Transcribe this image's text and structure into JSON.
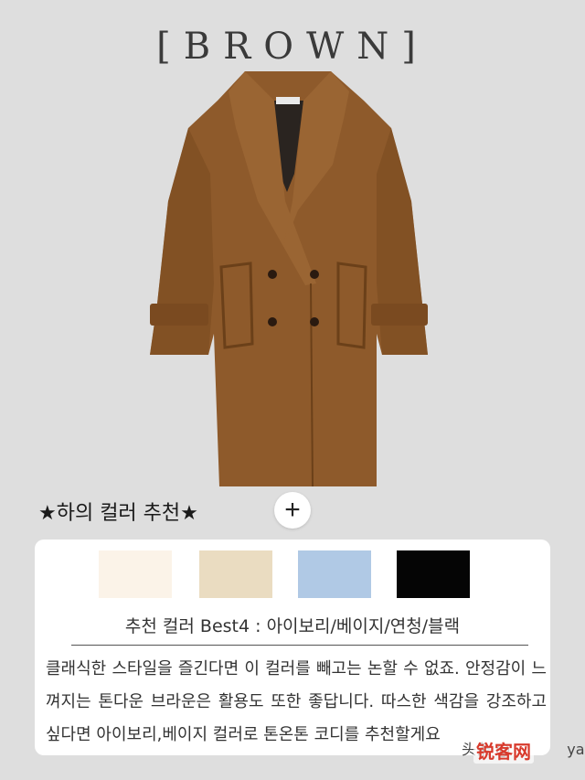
{
  "header": {
    "title": "[BROWN]"
  },
  "product": {
    "image_alt": "brown double-breasted wool coat"
  },
  "section": {
    "heading": "★하의 컬러 추천★",
    "plus_label": "+"
  },
  "swatches": [
    {
      "name": "아이보리",
      "color": "#fbf3e8"
    },
    {
      "name": "베이지",
      "color": "#eadcc1"
    },
    {
      "name": "연청",
      "color": "#b0c9e5"
    },
    {
      "name": "블랙",
      "color": "#050505"
    }
  ],
  "card": {
    "best_label": "추천 컬러 Best4 : 아이보리/베이지/연청/블랙",
    "description": "클래식한 스타일을 즐긴다면 이 컬러를 빼고는 논할 수 없죠. 안정감이 느껴지는 톤다운 브라운은 활용도 또한 좋답니다. 따스한 색감을 강조하고 싶다면 아이보리,베이지 컬러로 톤온톤 코디를 추천할게요"
  },
  "watermark": {
    "prefix": "头条 @",
    "suffix": "ya",
    "logo": "锐客网"
  }
}
